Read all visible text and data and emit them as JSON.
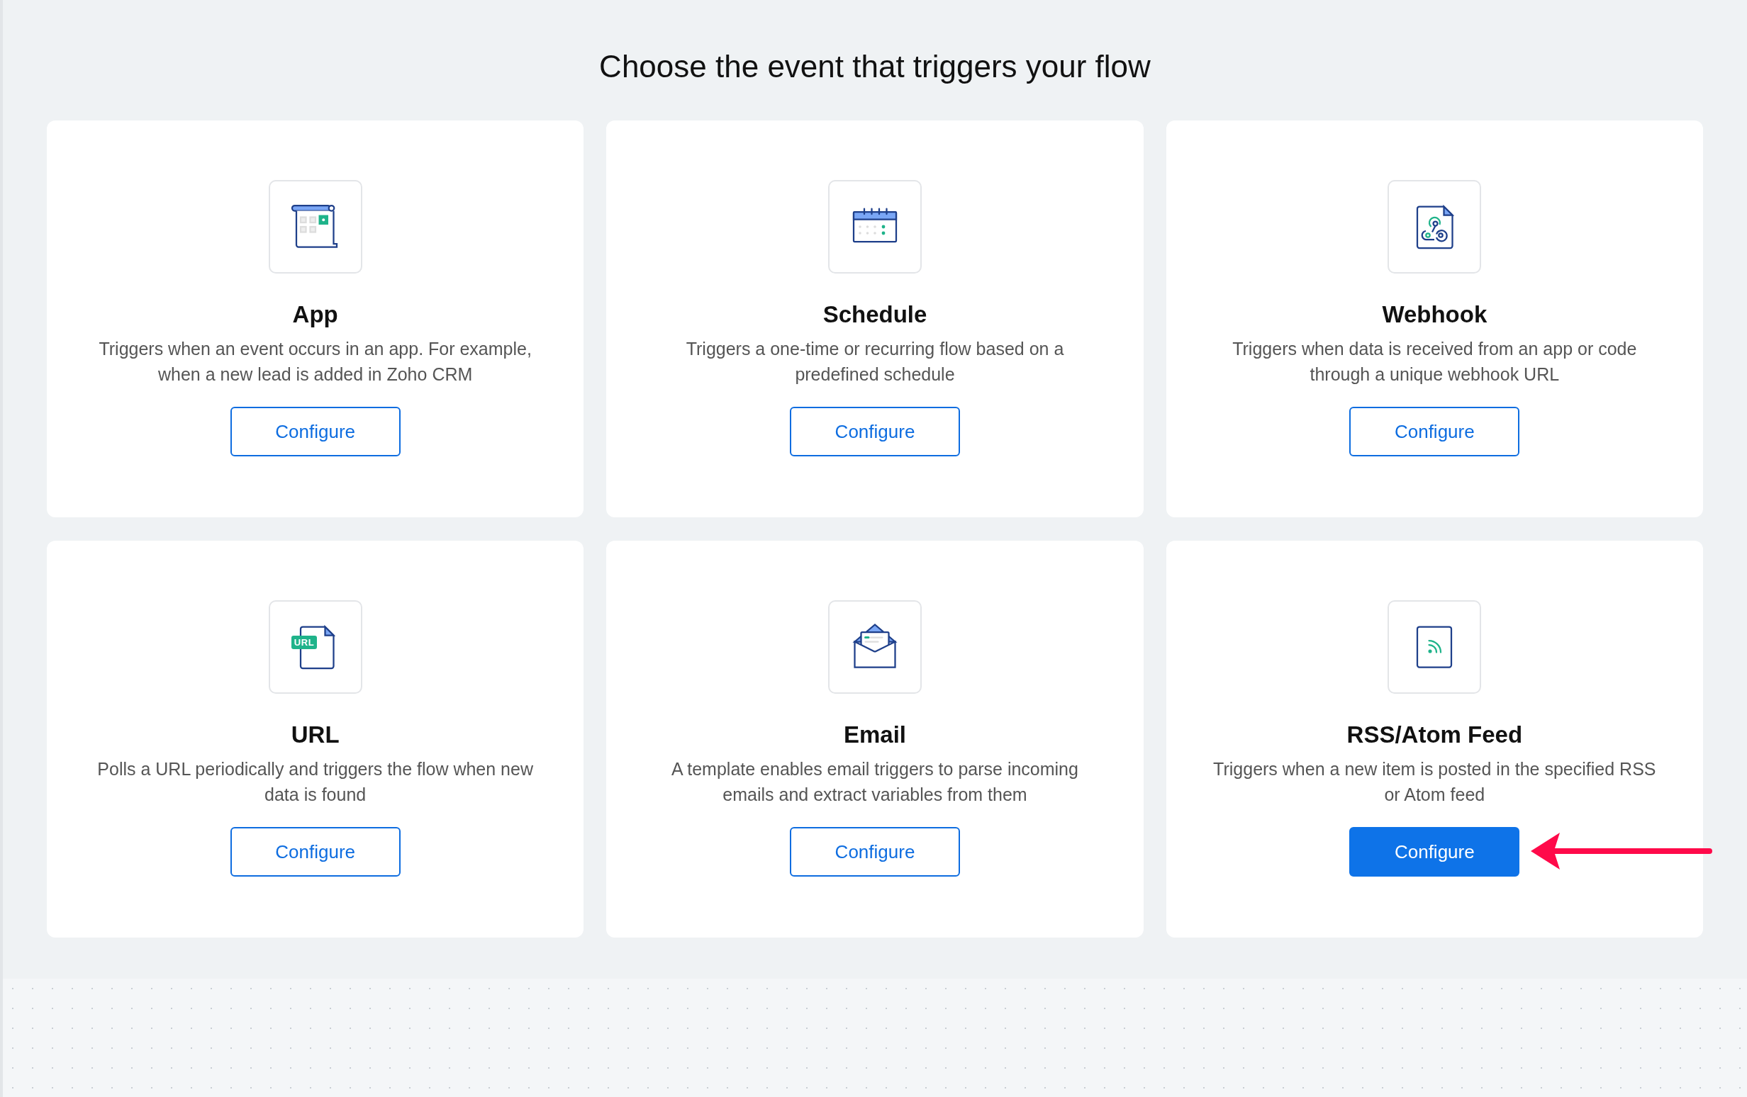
{
  "title": "Choose the event that triggers your flow",
  "cards": [
    {
      "kind": "app",
      "name": "App",
      "description": "Triggers when an event occurs in an app. For example, when a new lead is added in Zoho CRM",
      "button": "Configure",
      "highlighted": false,
      "pointer_arrow": false
    },
    {
      "kind": "schedule",
      "name": "Schedule",
      "description": "Triggers a one-time or recurring flow based on a predefined schedule",
      "button": "Configure",
      "highlighted": false,
      "pointer_arrow": false
    },
    {
      "kind": "webhook",
      "name": "Webhook",
      "description": "Triggers when data is received from an app or code through a unique webhook URL",
      "button": "Configure",
      "highlighted": false,
      "pointer_arrow": false
    },
    {
      "kind": "url",
      "icon_badge": "URL",
      "name": "URL",
      "description": "Polls a URL periodically and triggers the flow when new data is found",
      "button": "Configure",
      "highlighted": false,
      "pointer_arrow": false
    },
    {
      "kind": "email",
      "name": "Email",
      "description": "A template enables email triggers to parse incoming emails and extract variables from them",
      "button": "Configure",
      "highlighted": false,
      "pointer_arrow": false
    },
    {
      "kind": "rss",
      "name": "RSS/Atom Feed",
      "description": "Triggers when a new item is posted in the specified RSS or Atom feed",
      "button": "Configure",
      "highlighted": true,
      "pointer_arrow": true
    }
  ]
}
